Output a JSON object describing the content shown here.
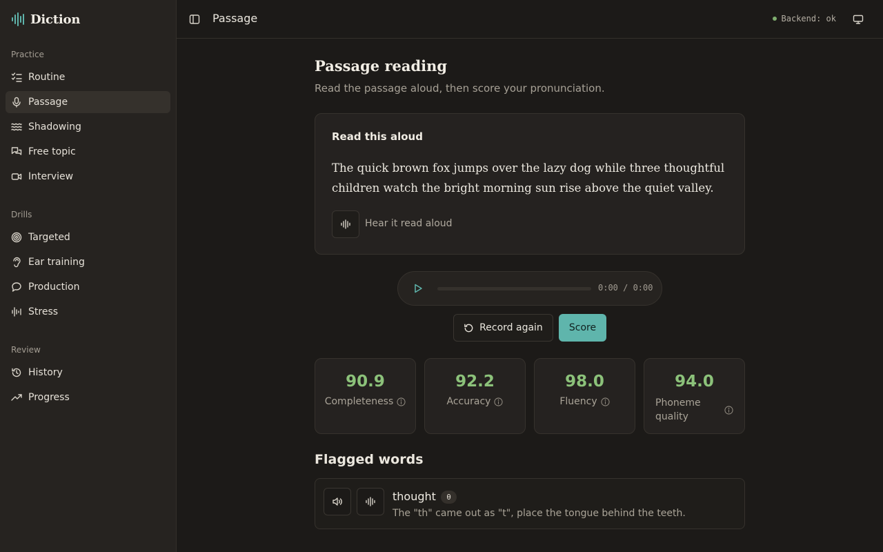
{
  "app": {
    "name": "Diction"
  },
  "sidebar": {
    "groups": [
      {
        "title": "Practice",
        "items": [
          {
            "label": "Routine",
            "icon": "checklist-icon"
          },
          {
            "label": "Passage",
            "icon": "microphone-icon",
            "active": true
          },
          {
            "label": "Shadowing",
            "icon": "waves-icon"
          },
          {
            "label": "Free topic",
            "icon": "chat-bubbles-icon"
          },
          {
            "label": "Interview",
            "icon": "video-camera-icon"
          }
        ]
      },
      {
        "title": "Drills",
        "items": [
          {
            "label": "Targeted",
            "icon": "target-icon"
          },
          {
            "label": "Ear training",
            "icon": "ear-icon"
          },
          {
            "label": "Production",
            "icon": "speech-bubble-icon"
          },
          {
            "label": "Stress",
            "icon": "stress-wave-icon"
          }
        ]
      },
      {
        "title": "Review",
        "items": [
          {
            "label": "History",
            "icon": "history-icon"
          },
          {
            "label": "Progress",
            "icon": "trending-up-icon"
          }
        ]
      }
    ]
  },
  "topbar": {
    "title": "Passage",
    "backend_status": "Backend: ok",
    "status_color": "#7fae6f"
  },
  "main": {
    "title": "Passage reading",
    "subtitle": "Read the passage aloud, then score your pronunciation.",
    "card": {
      "heading": "Read this aloud",
      "passage": "The quick brown fox jumps over the lazy dog while three thoughtful children watch the bright morning sun rise above the quiet valley.",
      "hear_label": "Hear it read aloud"
    },
    "player": {
      "time": "0:00 / 0:00",
      "progress": 0
    },
    "actions": {
      "record_again": "Record again",
      "score": "Score"
    },
    "metrics": [
      {
        "value": "90.9",
        "label": "Completeness"
      },
      {
        "value": "92.2",
        "label": "Accuracy"
      },
      {
        "value": "98.0",
        "label": "Fluency"
      },
      {
        "value": "94.0",
        "label": "Phoneme quality"
      }
    ],
    "flagged": {
      "title": "Flagged words",
      "items": [
        {
          "word": "thought",
          "phoneme": "θ",
          "hint": "The \"th\" came out as \"t\", place the tongue behind the teeth."
        }
      ]
    }
  },
  "colors": {
    "accent": "#5fb5ac",
    "score_green": "#8cc27a",
    "background": "#1c1a18",
    "sidebar": "#262320"
  }
}
